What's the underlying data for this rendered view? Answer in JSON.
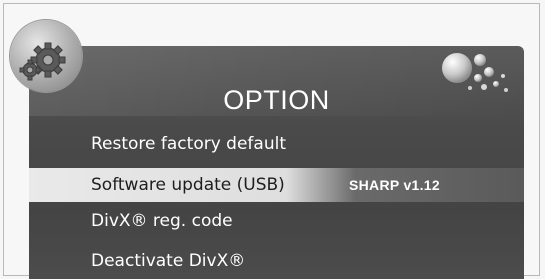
{
  "screen": {
    "title": "OPTION",
    "icons": {
      "badge": "gear-icon",
      "decoration": "bubbles-icon"
    }
  },
  "menu": {
    "items": [
      {
        "label": "Restore factory default",
        "value": ""
      },
      {
        "label": "Software update (USB)",
        "value": "SHARP v1.12",
        "selected": true
      },
      {
        "label": "DivX® reg. code",
        "value": ""
      },
      {
        "label": "Deactivate DivX®",
        "value": ""
      }
    ]
  }
}
